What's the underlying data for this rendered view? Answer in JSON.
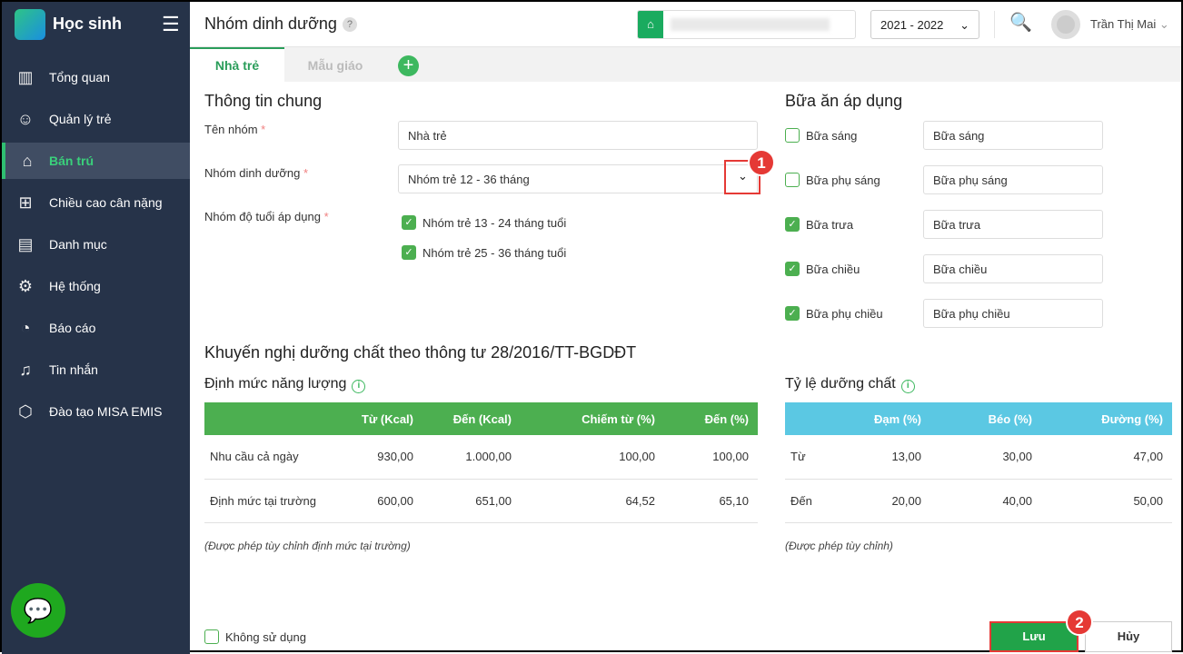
{
  "sidebar": {
    "brand": "Học sinh",
    "items": [
      {
        "label": "Tổng quan",
        "icon": "bar-chart-icon"
      },
      {
        "label": "Quản lý trẻ",
        "icon": "user-icon"
      },
      {
        "label": "Bán trú",
        "icon": "home-icon"
      },
      {
        "label": "Chiều cao cân nặng",
        "icon": "plus-box-icon"
      },
      {
        "label": "Danh mục",
        "icon": "folder-icon"
      },
      {
        "label": "Hệ thống",
        "icon": "gear-icon"
      },
      {
        "label": "Báo cáo",
        "icon": "pie-icon"
      },
      {
        "label": "Tin nhắn",
        "icon": "bell-icon"
      },
      {
        "label": "Đào tạo MISA EMIS",
        "icon": "box-icon"
      }
    ]
  },
  "header": {
    "title": "Nhóm dinh dưỡng",
    "help": "?",
    "year": "2021 - 2022",
    "user": "Trần Thị Mai"
  },
  "tabs": [
    "Nhà trẻ",
    "Mẫu giáo"
  ],
  "general": {
    "title": "Thông tin chung",
    "name_label": "Tên nhóm",
    "name_value": "Nhà trẻ",
    "group_label": "Nhóm dinh dưỡng",
    "group_value": "Nhóm trẻ 12 - 36 tháng",
    "age_label": "Nhóm độ tuổi áp dụng",
    "ages": [
      "Nhóm trẻ 13 - 24 tháng tuổi",
      "Nhóm trẻ 25 - 36 tháng tuổi"
    ],
    "req": "*"
  },
  "meals": {
    "title": "Bữa ăn áp dụng",
    "items": [
      {
        "label": "Bữa sáng",
        "value": "Bữa sáng",
        "checked": false
      },
      {
        "label": "Bữa phụ sáng",
        "value": "Bữa phụ sáng",
        "checked": false
      },
      {
        "label": "Bữa trưa",
        "value": "Bữa trưa",
        "checked": true
      },
      {
        "label": "Bữa chiều",
        "value": "Bữa chiều",
        "checked": true
      },
      {
        "label": "Bữa phụ chiều",
        "value": "Bữa phụ chiều",
        "checked": true
      }
    ]
  },
  "recommend": {
    "title": "Khuyến nghị dưỡng chất theo thông tư 28/2016/TT-BGDĐT",
    "energy": {
      "title": "Định mức năng lượng",
      "headers": [
        "",
        "Từ (Kcal)",
        "Đến (Kcal)",
        "Chiếm từ (%)",
        "Đến (%)"
      ],
      "rows": [
        [
          "Nhu cầu cả ngày",
          "930,00",
          "1.000,00",
          "100,00",
          "100,00"
        ],
        [
          "Định mức tại trường",
          "600,00",
          "651,00",
          "64,52",
          "65,10"
        ]
      ],
      "note": "(Được phép tùy chỉnh định mức tại trường)"
    },
    "ratio": {
      "title": "Tỷ lệ dưỡng chất",
      "headers": [
        "",
        "Đạm (%)",
        "Béo (%)",
        "Đường (%)"
      ],
      "rows": [
        [
          "Từ",
          "13,00",
          "30,00",
          "47,00"
        ],
        [
          "Đến",
          "20,00",
          "40,00",
          "50,00"
        ]
      ],
      "note": "(Được phép tùy chỉnh)"
    }
  },
  "footer": {
    "unused": "Không sử dụng",
    "save": "Lưu",
    "cancel": "Hủy"
  },
  "badges": [
    "1",
    "2"
  ],
  "colors": {
    "green": "#4caf50",
    "cyan": "#5bc8e3",
    "sidebar": "#263349"
  }
}
